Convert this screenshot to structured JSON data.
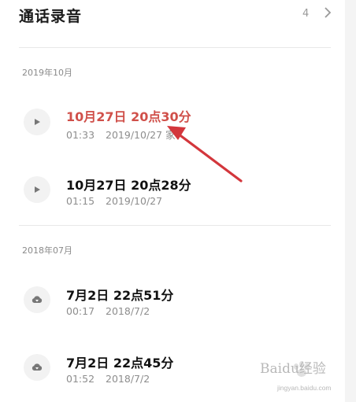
{
  "header": {
    "title": "通话录音",
    "count": "4"
  },
  "sections": [
    {
      "label": "2019年10月",
      "records": [
        {
          "title": "10月27日 20点30分",
          "duration": "01:33",
          "date": "2019/10/27",
          "extra": "家",
          "icon": "play-icon",
          "highlight": true
        },
        {
          "title": "10月27日 20点28分",
          "duration": "01:15",
          "date": "2019/10/27",
          "icon": "play-icon",
          "highlight": false
        }
      ]
    },
    {
      "label": "2018年07月",
      "records": [
        {
          "title": "7月2日 22点51分",
          "duration": "00:17",
          "date": "2018/7/2",
          "icon": "cloud-download-icon",
          "highlight": false
        },
        {
          "title": "7月2日 22点45分",
          "duration": "01:52",
          "date": "2018/7/2",
          "icon": "cloud-download-icon",
          "highlight": false
        }
      ]
    }
  ],
  "watermark": {
    "text": "Baidu经验",
    "sub": "jingyan.baidu.com"
  },
  "colors": {
    "highlight": "#d0504a",
    "arrow": "#d3363c"
  }
}
